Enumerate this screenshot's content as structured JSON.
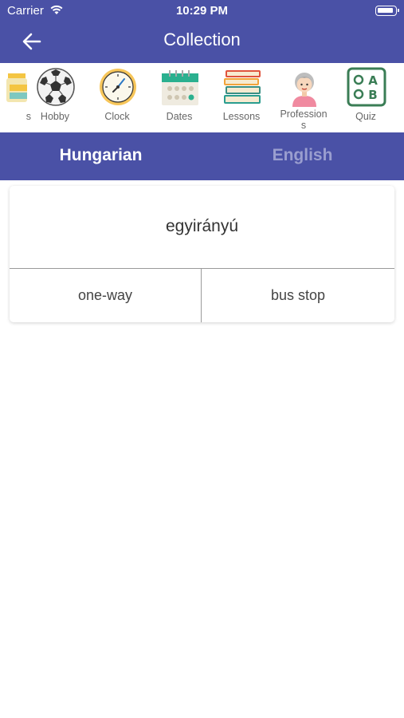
{
  "status": {
    "carrier": "Carrier",
    "time": "10:29 PM"
  },
  "header": {
    "title": "Collection"
  },
  "categories": [
    {
      "label": "s",
      "icon": "jar-icon"
    },
    {
      "label": "Hobby",
      "icon": "soccer-ball-icon"
    },
    {
      "label": "Clock",
      "icon": "clock-icon"
    },
    {
      "label": "Dates",
      "icon": "calendar-icon"
    },
    {
      "label": "Lessons",
      "icon": "books-icon"
    },
    {
      "label": "Profession",
      "label_line2": "s",
      "icon": "person-icon"
    },
    {
      "label": "Quiz",
      "icon": "quiz-icon"
    }
  ],
  "tabs": {
    "active": "Hungarian",
    "inactive": "English"
  },
  "card": {
    "word": "egyirányú",
    "options": [
      "one-way",
      "bus stop"
    ]
  },
  "colors": {
    "primary": "#4a51a6",
    "inactive_tab_text": "#9a9ecf"
  }
}
